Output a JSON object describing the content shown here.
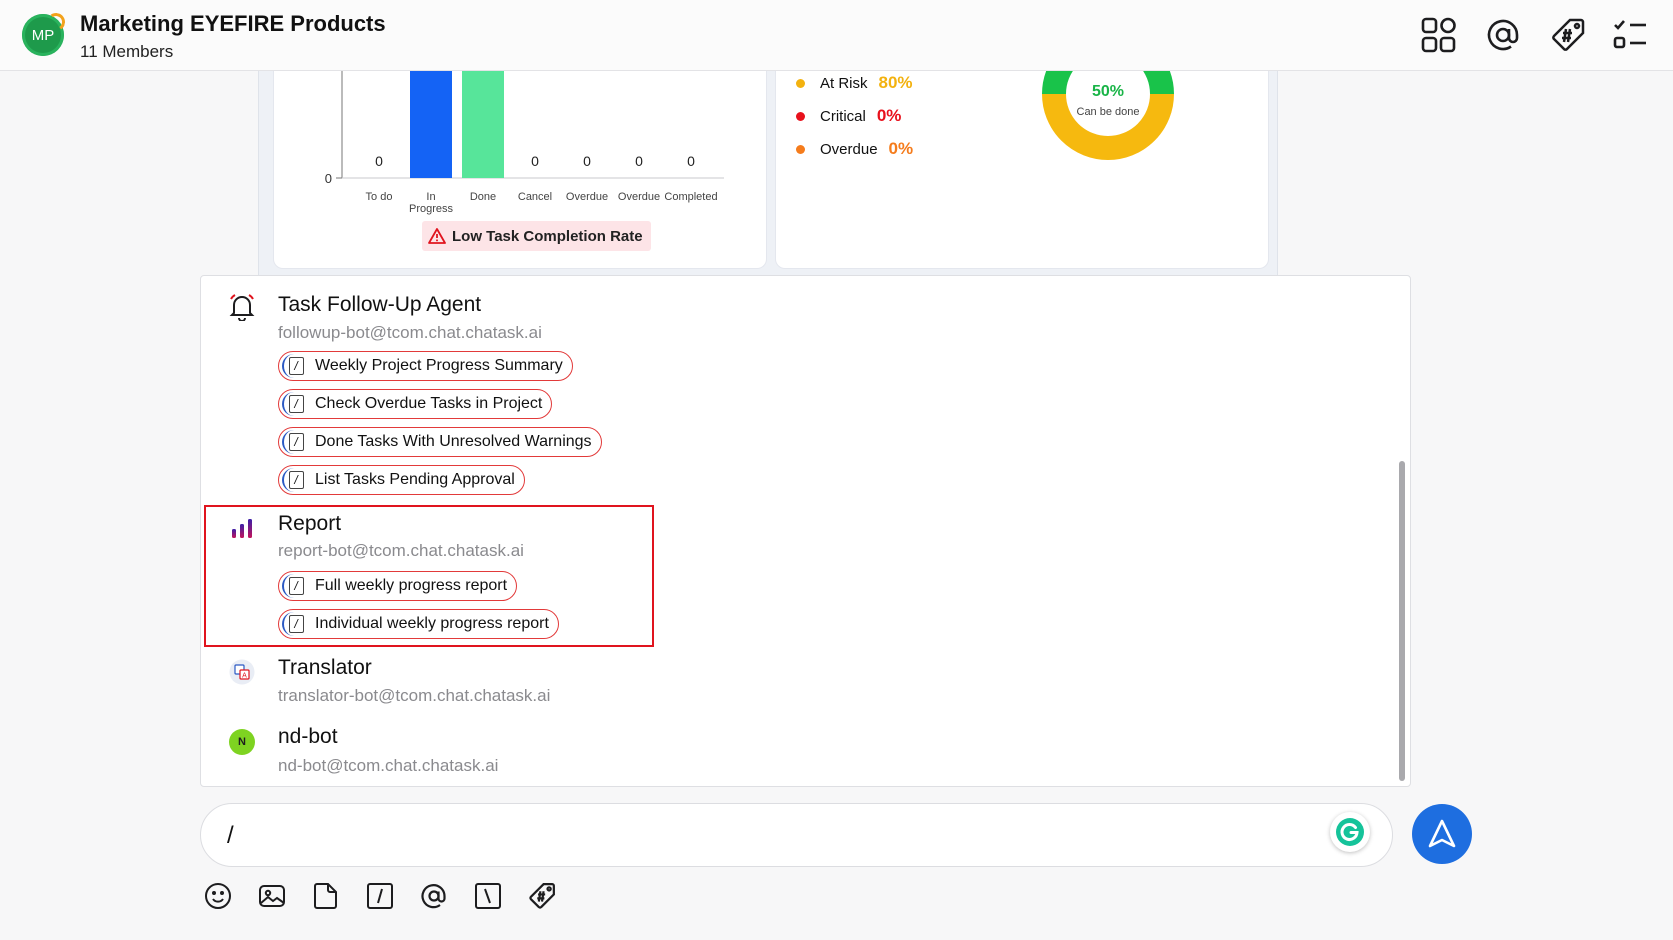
{
  "header": {
    "avatar_initials": "MP",
    "title": "Marketing EYEFIRE Products",
    "members": "11 Members",
    "icons": [
      "apps-icon",
      "mention-icon",
      "tag-icon",
      "task-list-icon"
    ]
  },
  "task_chart": {
    "zero_tick": "0",
    "categories": [
      "To do",
      "In Progress",
      "Done",
      "Cancel",
      "Overdue",
      "Overdue",
      "Completed"
    ],
    "value_labels": [
      "0",
      "",
      "",
      "0",
      "0",
      "0",
      "0"
    ],
    "alert": "Low Task Completion Rate"
  },
  "risk_legend": [
    {
      "label": "At Risk",
      "value": "80%",
      "color": "#f3b20f"
    },
    {
      "label": "Critical",
      "value": "0%",
      "color": "#e8111c"
    },
    {
      "label": "Overdue",
      "value": "0%",
      "color": "#f57c1c"
    }
  ],
  "donut": {
    "value": "50%",
    "caption": "Can be done",
    "percent_done": 50,
    "colors": {
      "done": "#19c34a",
      "remaining": "#f6b90f"
    }
  },
  "agents": [
    {
      "name": "Task Follow-Up Agent",
      "email": "followup-bot@tcom.chat.chatask.ai",
      "icon": "bell-icon",
      "commands": [
        "Weekly Project Progress Summary",
        "Check Overdue Tasks in Project",
        "Done Tasks With Unresolved Warnings",
        "List Tasks Pending Approval"
      ]
    },
    {
      "name": "Report",
      "email": "report-bot@tcom.chat.chatask.ai",
      "icon": "bar-chart-icon",
      "commands": [
        "Full weekly progress report",
        "Individual weekly progress report"
      ]
    },
    {
      "name": "Translator",
      "email": "translator-bot@tcom.chat.chatask.ai",
      "icon": "translate-icon",
      "commands": []
    },
    {
      "name": "nd-bot",
      "email": "nd-bot@tcom.chat.chatask.ai",
      "icon": "nd-bot-avatar",
      "avatar_letter": "N",
      "commands": []
    }
  ],
  "composer": {
    "value": "/",
    "toolbar": [
      "emoji-icon",
      "image-icon",
      "file-icon",
      "slash-command-icon",
      "mention-icon",
      "backslash-icon",
      "hashtag-icon"
    ]
  },
  "colors": {
    "accent": "#1e6ee0",
    "bar_in_progress": "#1463f5",
    "bar_done": "#57e59a",
    "highlight": "#e0141e"
  }
}
